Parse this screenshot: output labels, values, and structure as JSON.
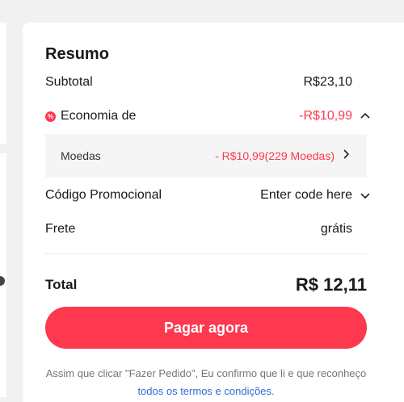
{
  "summary": {
    "title": "Resumo",
    "subtotal_label": "Subtotal",
    "subtotal_value": "R$23,10",
    "savings_label": "Economia de",
    "savings_value": "-R$10,99",
    "coins_label": "Moedas",
    "coins_value": "- R$10,99(229 Moedas)",
    "promo_label": "Código Promocional",
    "promo_placeholder": "Enter code here",
    "shipping_label": "Frete",
    "shipping_value": "grátis",
    "total_label": "Total",
    "total_value": "R$ 12,11",
    "pay_button": "Pagar agora",
    "terms_text": "Assim que clicar \"Fazer Pedido\", Eu confirmo que li e que reconheço ",
    "terms_link": "todos os termos e condições",
    "terms_end": "."
  },
  "colors": {
    "accent": "#fd384f",
    "link": "#2e6bd8"
  },
  "icons": {
    "discount": "discount-badge-icon",
    "expand": "chevron-up-icon",
    "coins": "chevron-right-icon",
    "promo": "chevron-down-icon"
  }
}
